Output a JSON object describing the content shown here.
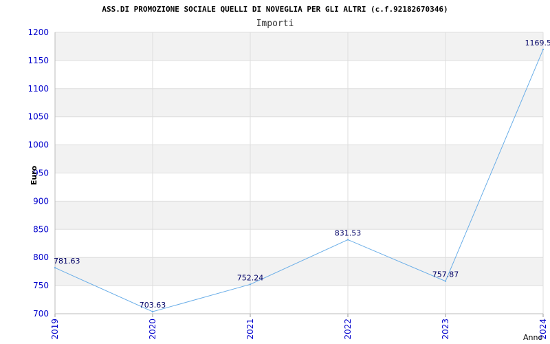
{
  "chart_data": {
    "type": "line",
    "title": "ASS.DI PROMOZIONE SOCIALE QUELLI DI NOVEGLIA PER GLI ALTRI (c.f.92182670346)",
    "subtitle": "Importi",
    "xlabel": "Anno",
    "ylabel": "Euro",
    "categories": [
      "2019",
      "2020",
      "2021",
      "2022",
      "2023",
      "2024"
    ],
    "series": [
      {
        "values": [
          781.63,
          703.63,
          752.24,
          831.53,
          757.87,
          1169.5
        ]
      }
    ],
    "data_labels": [
      "781.63",
      "703.63",
      "752.24",
      "831.53",
      "757.87",
      "1169.5"
    ],
    "ylim": [
      700,
      1200
    ],
    "yticks": [
      "700",
      "750",
      "800",
      "850",
      "900",
      "950",
      "1000",
      "1050",
      "1100",
      "1150",
      "1200"
    ],
    "grid": true,
    "colors": {
      "line": "#6aaee8",
      "band": "#f2f2f2",
      "grid": "#dddddd",
      "tick_text": "#0000cc"
    }
  }
}
